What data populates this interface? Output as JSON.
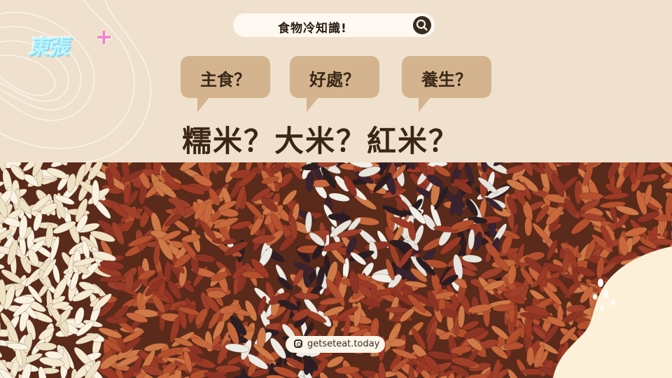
{
  "brand": {
    "logo_text": "東張",
    "logo_plus": "+"
  },
  "search": {
    "text": "食物冷知識!",
    "icon": "search-icon"
  },
  "bubbles": [
    {
      "label": "主食？"
    },
    {
      "label": "好處？"
    },
    {
      "label": "養生？"
    }
  ],
  "headline": "糯米？大米？紅米？",
  "social": {
    "icon": "instagram-icon",
    "handle": "getseteat.today"
  },
  "colors": {
    "background": "#efe1cd",
    "bubble": "#d3b48f",
    "text_dark": "#3b2615",
    "logo_cyan": "#bdf3ff",
    "logo_pink": "#f17fd0",
    "blob": "#fcf1d8"
  }
}
